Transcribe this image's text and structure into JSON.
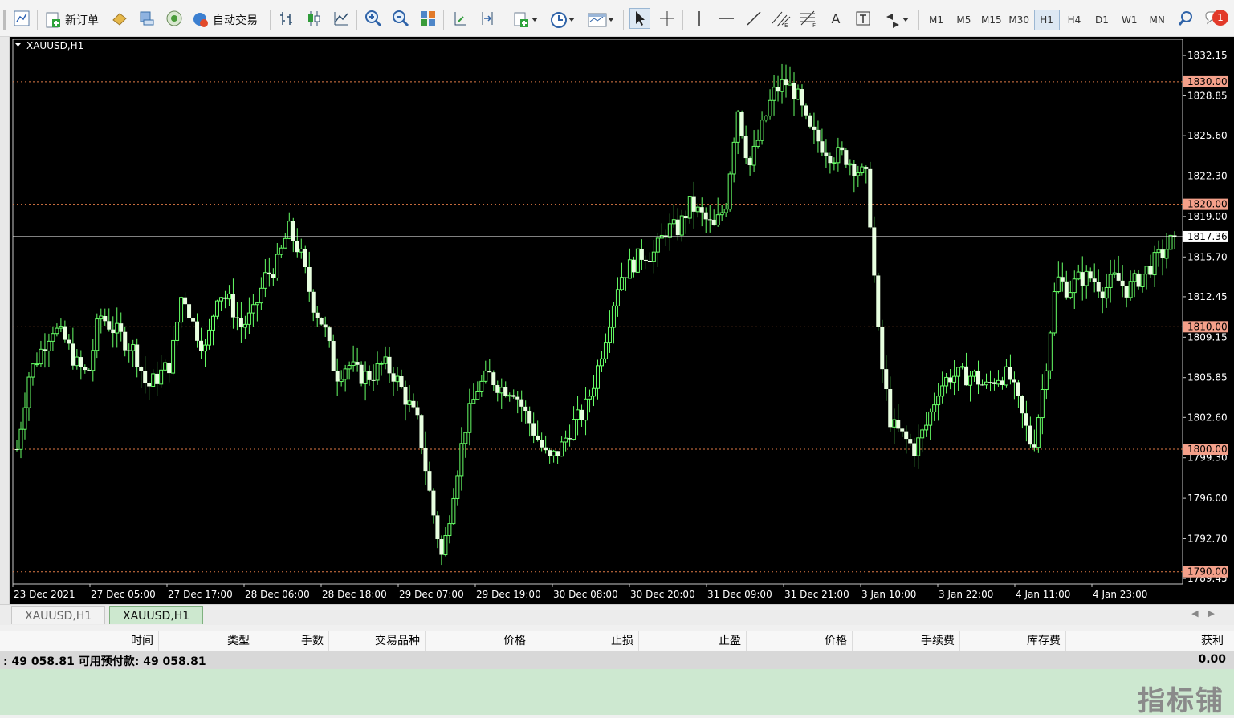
{
  "toolbar": {
    "new_order_label": "新订单",
    "autotrade_label": "自动交易",
    "timeframes": [
      "M1",
      "M5",
      "M15",
      "M30",
      "H1",
      "H4",
      "D1",
      "W1",
      "MN"
    ],
    "active_timeframe": "H1",
    "notification_count": "1",
    "text_tool_label": "A"
  },
  "chart": {
    "symbol_label": "XAUUSD,H1",
    "current_price_label": "1817.36",
    "colors": {
      "background": "#000000",
      "candle": "#66ff66",
      "level_line": "#e07a46",
      "level_label_bg": "#f4a08a",
      "current_price_line": "#ffffff"
    }
  },
  "chart_data": {
    "type": "candlestick",
    "symbol": "XAUUSD",
    "timeframe": "H1",
    "ylim": [
      1789.0,
      1833.4
    ],
    "y_ticks": [
      "1832.15",
      "1828.85",
      "1825.60",
      "1822.30",
      "1819.00",
      "1815.70",
      "1812.45",
      "1809.15",
      "1805.85",
      "1802.60",
      "1799.30",
      "1796.00",
      "1792.70",
      "1789.45"
    ],
    "horizontal_levels": [
      "1830.00",
      "1820.00",
      "1810.00",
      "1800.00",
      "1790.00"
    ],
    "current_price": 1817.36,
    "x_tick_labels": [
      "23 Dec 2021",
      "27 Dec 05:00",
      "27 Dec 17:00",
      "28 Dec 06:00",
      "28 Dec 18:00",
      "29 Dec 07:00",
      "29 Dec 19:00",
      "30 Dec 08:00",
      "30 Dec 20:00",
      "31 Dec 09:00",
      "31 Dec 21:00",
      "3 Jan 10:00",
      "3 Jan 22:00",
      "4 Jan 11:00",
      "4 Jan 23:00"
    ],
    "close_path": [
      1800,
      1806,
      1808,
      1810,
      1809,
      1807,
      1806,
      1811,
      1810,
      1809,
      1808,
      1805,
      1806,
      1807,
      1813,
      1810,
      1808,
      1813,
      1812,
      1810,
      1811,
      1814,
      1815,
      1818,
      1816,
      1812,
      1810,
      1806,
      1807,
      1806,
      1806,
      1807,
      1806,
      1804,
      1802,
      1796,
      1791,
      1797,
      1802,
      1805,
      1806,
      1805,
      1805,
      1803,
      1801,
      1799,
      1800,
      1802,
      1803,
      1806,
      1810,
      1814,
      1815,
      1816,
      1816,
      1818,
      1818,
      1820,
      1819,
      1818,
      1820,
      1828,
      1823,
      1826,
      1829,
      1830,
      1829,
      1826,
      1825,
      1824,
      1824,
      1823,
      1822,
      1808,
      1802,
      1801,
      1800,
      1802,
      1805,
      1806,
      1806,
      1806,
      1805,
      1806,
      1806,
      1803,
      1800,
      1806,
      1814,
      1813,
      1814,
      1814,
      1813,
      1814,
      1813,
      1814,
      1815,
      1816,
      1817.36
    ]
  },
  "tabs": [
    {
      "label": "XAUUSD,H1"
    },
    {
      "label": "XAUUSD,H1"
    }
  ],
  "terminal": {
    "columns": [
      "时间",
      "类型",
      "手数",
      "交易品种",
      "价格",
      "止损",
      "止盈",
      "价格",
      "手续费",
      "库存费",
      "获利"
    ],
    "summary_left": ": 49 058.81  可用预付款: 49 058.81",
    "summary_right": "0.00",
    "watermark": "指标铺"
  }
}
